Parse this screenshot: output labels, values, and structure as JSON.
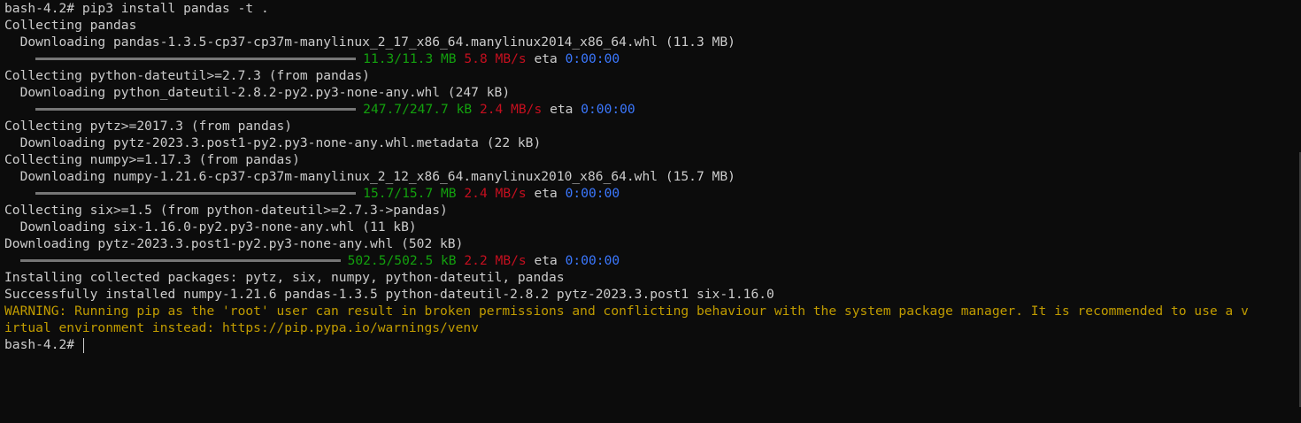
{
  "lines": {
    "l1": "bash-4.2# pip3 install pandas -t .",
    "l2": "Collecting pandas",
    "l3": "  Downloading pandas-1.3.5-cp37-cp37m-manylinux_2_17_x86_64.manylinux2014_x86_64.whl (11.3 MB)",
    "l5": "Collecting python-dateutil>=2.7.3 (from pandas)",
    "l6": "  Downloading python_dateutil-2.8.2-py2.py3-none-any.whl (247 kB)",
    "l8": "Collecting pytz>=2017.3 (from pandas)",
    "l9": "  Downloading pytz-2023.3.post1-py2.py3-none-any.whl.metadata (22 kB)",
    "l10": "Collecting numpy>=1.17.3 (from pandas)",
    "l11": "  Downloading numpy-1.21.6-cp37-cp37m-manylinux_2_12_x86_64.manylinux2010_x86_64.whl (15.7 MB)",
    "l13": "Collecting six>=1.5 (from python-dateutil>=2.7.3->pandas)",
    "l14": "  Downloading six-1.16.0-py2.py3-none-any.whl (11 kB)",
    "l15": "Downloading pytz-2023.3.post1-py2.py3-none-any.whl (502 kB)",
    "l17": "Installing collected packages: pytz, six, numpy, python-dateutil, pandas",
    "l18": "Successfully installed numpy-1.21.6 pandas-1.3.5 python-dateutil-2.8.2 pytz-2023.3.post1 six-1.16.0",
    "l19": "WARNING: Running pip as the 'root' user can result in broken permissions and conflicting behaviour with the system package manager. It is recommended to use a v",
    "l20": "irtual environment instead: https://pip.pypa.io/warnings/venv",
    "prompt": "bash-4.2# "
  },
  "progress": [
    {
      "size": "11.3/11.3 MB",
      "speed": "5.8 MB/s",
      "eta_label": "eta",
      "eta": "0:00:00",
      "fraction": 1.0
    },
    {
      "size": "247.7/247.7 kB",
      "speed": "2.4 MB/s",
      "eta_label": "eta",
      "eta": "0:00:00",
      "fraction": 1.0
    },
    {
      "size": "15.7/15.7 MB",
      "speed": "2.4 MB/s",
      "eta_label": "eta",
      "eta": "0:00:00",
      "fraction": 1.0
    },
    {
      "size": "502.5/502.5 kB",
      "speed": "2.2 MB/s",
      "eta_label": "eta",
      "eta": "0:00:00",
      "fraction": 1.0
    }
  ],
  "colors": {
    "background": "#0c0c0c",
    "foreground": "#cccccc",
    "green": "#13a10e",
    "red": "#c50f1f",
    "blue": "#3b78ff",
    "yellow": "#c19c00"
  }
}
